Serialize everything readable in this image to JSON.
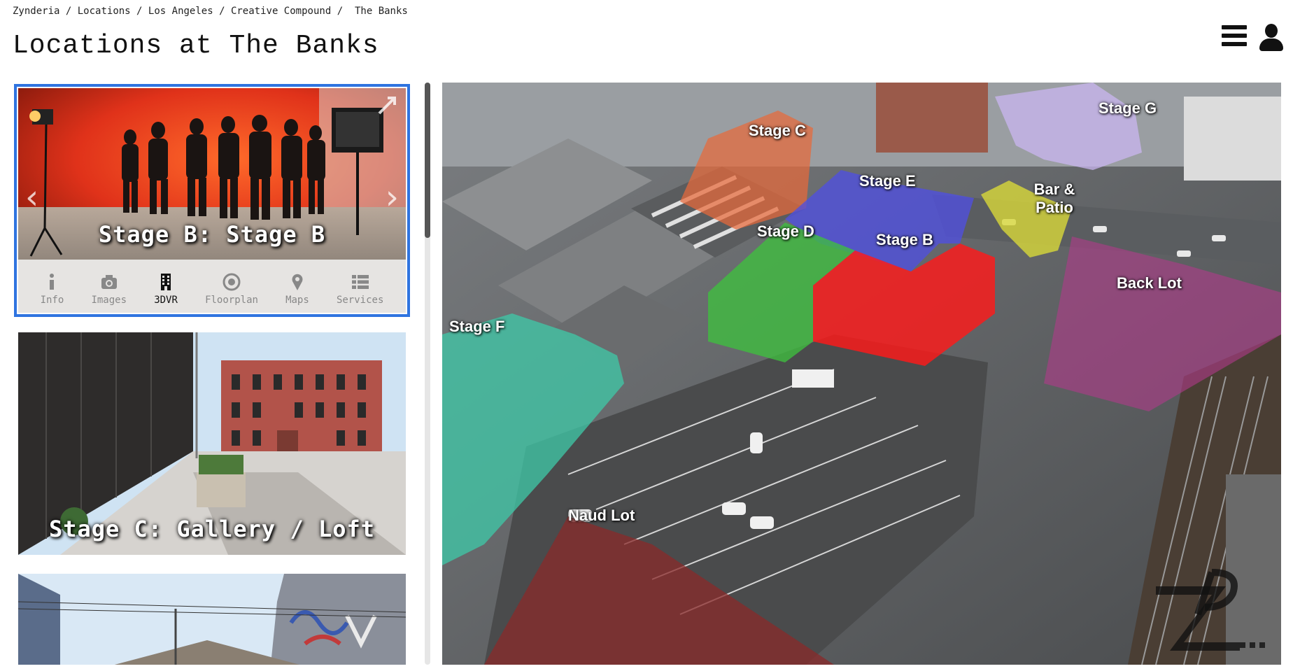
{
  "breadcrumb": {
    "items": [
      "Zynderia",
      "Locations",
      "Los Angeles",
      "Creative Compound",
      "The Banks"
    ],
    "separator": "/"
  },
  "page_title": "Locations at The Banks",
  "header_icons": {
    "menu": "hamburger-menu-icon",
    "user": "user-icon"
  },
  "location_cards": [
    {
      "caption": "Stage B: Stage B",
      "selected": true,
      "tabs": [
        {
          "label": "Info",
          "icon": "info-icon",
          "active": false
        },
        {
          "label": "Images",
          "icon": "camera-icon",
          "active": false
        },
        {
          "label": "3DVR",
          "icon": "building-icon",
          "active": true
        },
        {
          "label": "Floorplan",
          "icon": "target-icon",
          "active": false
        },
        {
          "label": "Maps",
          "icon": "map-pin-icon",
          "active": false
        },
        {
          "label": "Services",
          "icon": "list-icon",
          "active": false
        }
      ]
    },
    {
      "caption": "Stage C: Gallery / Loft",
      "selected": false
    },
    {
      "caption": "",
      "selected": false
    }
  ],
  "map": {
    "zones": [
      {
        "name": "Stage C",
        "color": "#e86a3a"
      },
      {
        "name": "Stage E",
        "color": "#5050e0"
      },
      {
        "name": "Stage D",
        "color": "#3fbf3f"
      },
      {
        "name": "Stage B",
        "color": "#ff1a1a"
      },
      {
        "name": "Stage G",
        "color": "#c9b6f0"
      },
      {
        "name": "Bar & Patio",
        "color": "#d8d83a"
      },
      {
        "name": "Back Lot",
        "color": "#b03a8a"
      },
      {
        "name": "Stage F",
        "color": "#3fc9a8"
      },
      {
        "name": "Naud Lot",
        "color": "#8a2a2a"
      }
    ],
    "watermark": "ZP"
  },
  "colors": {
    "selected_border": "#2f74e0",
    "tabbar_bg": "#e6e4e2"
  }
}
